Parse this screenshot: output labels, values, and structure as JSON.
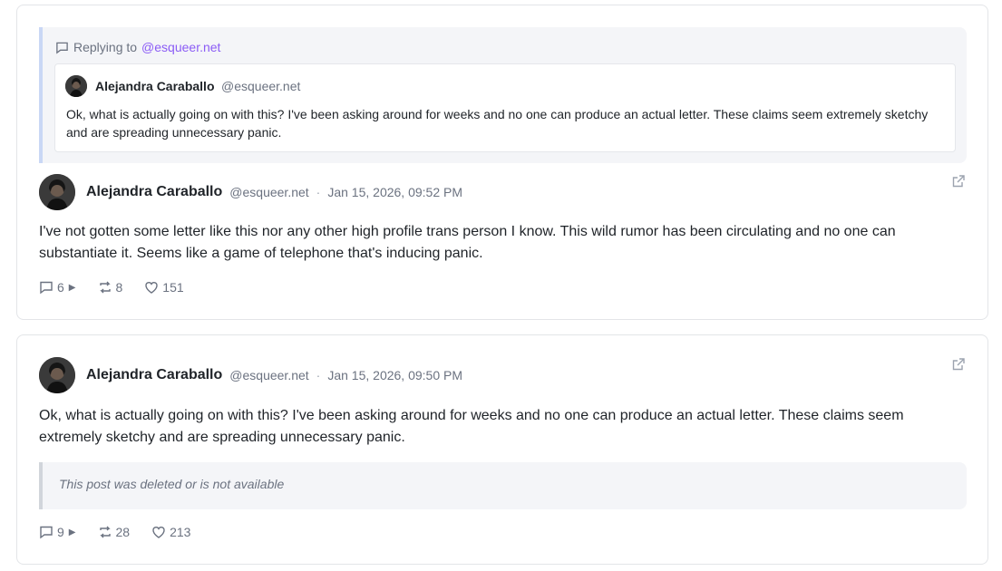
{
  "post1": {
    "reply_context": {
      "prefix": "Replying to",
      "handle": "@esqueer.net",
      "quoted": {
        "name": "Alejandra Caraballo",
        "handle": "@esqueer.net",
        "text": "Ok, what is actually going on with this? I've been asking around for weeks and no one can produce an actual letter. These claims seem extremely sketchy and are spreading unnecessary panic."
      }
    },
    "name": "Alejandra Caraballo",
    "handle": "@esqueer.net",
    "separator": "·",
    "time": "Jan 15, 2026, 09:52 PM",
    "text": "I've not gotten some letter like this nor any other high profile trans person I know. This wild rumor has been circulating and no one can substantiate it. Seems like a game of telephone that's inducing panic.",
    "replies": "6",
    "reposts": "8",
    "likes": "151"
  },
  "post2": {
    "name": "Alejandra Caraballo",
    "handle": "@esqueer.net",
    "separator": "·",
    "time": "Jan 15, 2026, 09:50 PM",
    "text": "Ok, what is actually going on with this? I've been asking around for weeks and no one can produce an actual letter. These claims seem extremely sketchy and are spreading unnecessary panic.",
    "deleted_notice": "This post was deleted or is not available",
    "replies": "9",
    "reposts": "28",
    "likes": "213"
  },
  "icons": {
    "comment": "comment-icon",
    "repost": "repost-icon",
    "like": "heart-icon",
    "external": "external-link-icon",
    "expand": "play-icon"
  }
}
